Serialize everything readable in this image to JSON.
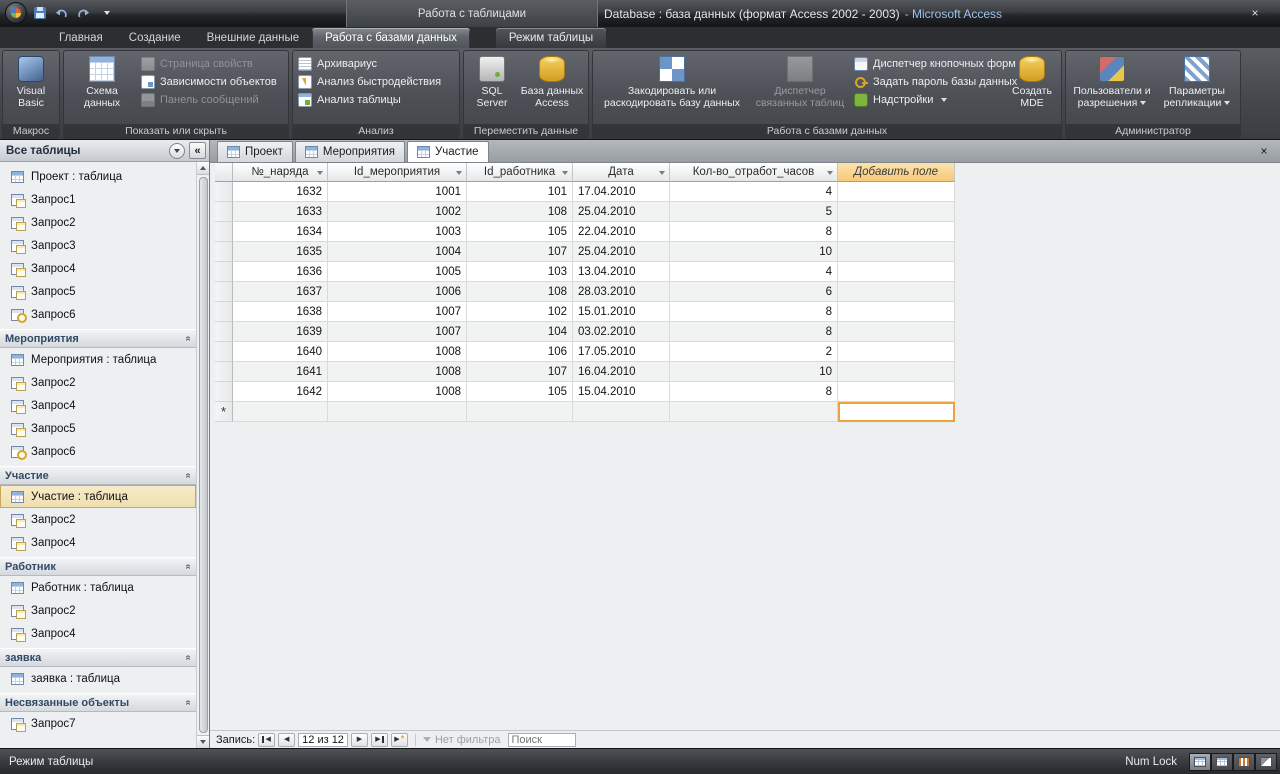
{
  "glyphs": {
    "close": "×",
    "shutter": "«",
    "prev": "◀",
    "next": "▶",
    "star": "*"
  },
  "title_bar": {
    "context_label": "Работа с таблицами",
    "title": "Database : база данных (формат Access 2002 - 2003)",
    "app_name": "- Microsoft Access"
  },
  "ribbon_tabs": [
    {
      "label": "Главная"
    },
    {
      "label": "Создание"
    },
    {
      "label": "Внешние данные"
    },
    {
      "label": "Работа с базами данных",
      "active": true
    },
    {
      "label": "Режим таблицы",
      "contextual": true
    }
  ],
  "ribbon": {
    "macro_group": {
      "label": "Макрос",
      "visual_basic": "Visual Basic"
    },
    "show_hide_group": {
      "label": "Показать или скрыть",
      "schema": "Схема данных",
      "property_page": "Страница свойств",
      "dependencies": "Зависимости объектов",
      "message_bar": "Панель сообщений"
    },
    "analysis_group": {
      "label": "Анализ",
      "documenter": "Архивариус",
      "performance": "Анализ быстродействия",
      "table_analyze": "Анализ таблицы"
    },
    "move_group": {
      "label": "Переместить данные",
      "sql_server": "SQL Server",
      "access_db": "База данных Access"
    },
    "dbtools_group": {
      "label": "Работа с базами данных",
      "encode": "Закодировать или раскодировать базу данных",
      "linked_manager": "Диспетчер связанных таблиц",
      "switchboard": "Диспетчер кнопочных форм",
      "password": "Задать пароль базы данных",
      "addins": "Надстройки",
      "make_mde": "Создать MDE"
    },
    "admin_group": {
      "label": "Администратор",
      "users": "Пользователи и разрешения",
      "replication": "Параметры репликации"
    }
  },
  "nav_pane": {
    "header": "Все таблицы",
    "sections": [
      {
        "header": null,
        "items": [
          {
            "label": "Проект : таблица",
            "icon": "table-icon"
          },
          {
            "label": "Запрос1",
            "icon": "query-icon"
          },
          {
            "label": "Запрос2",
            "icon": "query-icon"
          },
          {
            "label": "Запрос3",
            "icon": "query-icon"
          },
          {
            "label": "Запрос4",
            "icon": "query-icon"
          },
          {
            "label": "Запрос5",
            "icon": "query-icon"
          },
          {
            "label": "Запрос6",
            "icon": "key-query-icon"
          }
        ]
      },
      {
        "header": "Мероприятия",
        "items": [
          {
            "label": "Мероприятия : таблица",
            "icon": "table-icon"
          },
          {
            "label": "Запрос2",
            "icon": "query-icon"
          },
          {
            "label": "Запрос4",
            "icon": "query-icon"
          },
          {
            "label": "Запрос5",
            "icon": "query-icon"
          },
          {
            "label": "Запрос6",
            "icon": "key-query-icon"
          }
        ]
      },
      {
        "header": "Участие",
        "items": [
          {
            "label": "Участие : таблица",
            "icon": "table-icon",
            "selected": true
          },
          {
            "label": "Запрос2",
            "icon": "query-icon"
          },
          {
            "label": "Запрос4",
            "icon": "query-icon"
          }
        ]
      },
      {
        "header": "Работник",
        "items": [
          {
            "label": "Работник : таблица",
            "icon": "table-icon"
          },
          {
            "label": "Запрос2",
            "icon": "query-icon"
          },
          {
            "label": "Запрос4",
            "icon": "query-icon"
          }
        ]
      },
      {
        "header": "заявка",
        "items": [
          {
            "label": "заявка : таблица",
            "icon": "table-icon"
          }
        ]
      },
      {
        "header": "Несвязанные объекты",
        "items": [
          {
            "label": "Запрос7",
            "icon": "query-icon"
          }
        ]
      }
    ]
  },
  "document_tabs": [
    {
      "label": "Проект"
    },
    {
      "label": "Мероприятия"
    },
    {
      "label": "Участие",
      "active": true
    }
  ],
  "datasheet": {
    "columns": [
      "№_наряда",
      "Id_мероприятия",
      "Id_работника",
      "Дата",
      "Кол-во_отработ_часов"
    ],
    "add_field_column": "Добавить поле",
    "rows": [
      [
        "1632",
        "1001",
        "101",
        "17.04.2010",
        "4"
      ],
      [
        "1633",
        "1002",
        "108",
        "25.04.2010",
        "5"
      ],
      [
        "1634",
        "1003",
        "105",
        "22.04.2010",
        "8"
      ],
      [
        "1635",
        "1004",
        "107",
        "25.04.2010",
        "10"
      ],
      [
        "1636",
        "1005",
        "103",
        "13.04.2010",
        "4"
      ],
      [
        "1637",
        "1006",
        "108",
        "28.03.2010",
        "6"
      ],
      [
        "1638",
        "1007",
        "102",
        "15.01.2010",
        "8"
      ],
      [
        "1639",
        "1007",
        "104",
        "03.02.2010",
        "8"
      ],
      [
        "1640",
        "1008",
        "106",
        "17.05.2010",
        "2"
      ],
      [
        "1641",
        "1008",
        "107",
        "16.04.2010",
        "10"
      ],
      [
        "1642",
        "1008",
        "105",
        "15.04.2010",
        "8"
      ]
    ],
    "new_row_marker": "*"
  },
  "record_nav": {
    "label": "Запись:",
    "position": "12 из 12",
    "no_filter": "Нет фильтра",
    "search_placeholder": "Поиск"
  },
  "status_bar": {
    "left": "Режим таблицы",
    "num_lock": "Num Lock"
  }
}
